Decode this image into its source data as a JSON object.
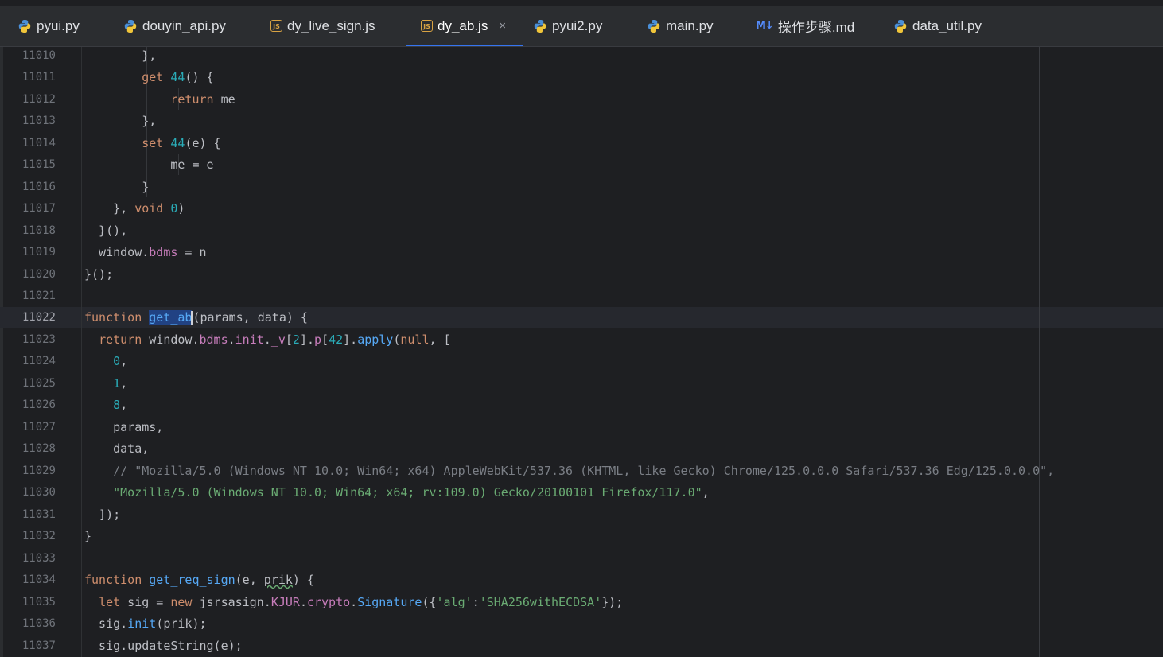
{
  "tabs": [
    {
      "label": "pyui.py",
      "icon": "python-icon"
    },
    {
      "label": "douyin_api.py",
      "icon": "python-icon"
    },
    {
      "label": "dy_live_sign.js",
      "icon": "js-icon"
    },
    {
      "label": "dy_ab.js",
      "icon": "js-icon",
      "active": true
    },
    {
      "label": "pyui2.py",
      "icon": "python-icon"
    },
    {
      "label": "main.py",
      "icon": "python-icon"
    },
    {
      "label": "操作步骤.md",
      "icon": "markdown-icon"
    },
    {
      "label": "data_util.py",
      "icon": "python-icon"
    }
  ],
  "tab_close_glyph": "×",
  "icon_glyphs": {
    "js": "JS",
    "md": "M↓"
  },
  "editor": {
    "current_line": "11022",
    "lines": [
      {
        "n": "11010",
        "t": [
          "        },"
        ]
      },
      {
        "n": "11011",
        "t": [
          "        ",
          "get",
          " ",
          "44",
          "() {"
        ]
      },
      {
        "n": "11012",
        "t": [
          "            ",
          "return",
          " me"
        ]
      },
      {
        "n": "11013",
        "t": [
          "        },"
        ]
      },
      {
        "n": "11014",
        "t": [
          "        ",
          "set",
          " ",
          "44",
          "(e) {"
        ]
      },
      {
        "n": "11015",
        "t": [
          "            me = e"
        ]
      },
      {
        "n": "11016",
        "t": [
          "        }"
        ]
      },
      {
        "n": "11017",
        "t": [
          "    }, ",
          "void",
          " ",
          "0",
          ")"
        ]
      },
      {
        "n": "11018",
        "t": [
          "  }(),"
        ]
      },
      {
        "n": "11019",
        "t": [
          "  window.",
          "bdms",
          " = n"
        ]
      },
      {
        "n": "11020",
        "t": [
          "}();"
        ]
      },
      {
        "n": "11021",
        "t": [
          ""
        ]
      },
      {
        "n": "11022",
        "t": [
          "function",
          " ",
          "get_ab",
          "(params, data) {"
        ]
      },
      {
        "n": "11023",
        "t": [
          "  ",
          "return",
          " window.",
          "bdms",
          ".",
          "init",
          ".",
          "_v",
          "[",
          "2",
          "].",
          "p",
          "[",
          "42",
          "].",
          "apply",
          "(",
          "null",
          ", ["
        ]
      },
      {
        "n": "11024",
        "t": [
          "    ",
          "0",
          ","
        ]
      },
      {
        "n": "11025",
        "t": [
          "    ",
          "1",
          ","
        ]
      },
      {
        "n": "11026",
        "t": [
          "    ",
          "8",
          ","
        ]
      },
      {
        "n": "11027",
        "t": [
          "    params,"
        ]
      },
      {
        "n": "11028",
        "t": [
          "    data,"
        ]
      },
      {
        "n": "11029",
        "t": [
          "    // \"Mozilla/5.0 (Windows NT 10.0; Win64; x64) AppleWebKit/537.36 (",
          "KHTML",
          ", like Gecko) Chrome/125.0.0.0 Safari/537.36 Edg/125.0.0.0\","
        ]
      },
      {
        "n": "11030",
        "t": [
          "    ",
          "\"Mozilla/5.0 (Windows NT 10.0; Win64; x64; rv:109.0) Gecko/20100101 Firefox/117.0\"",
          ","
        ]
      },
      {
        "n": "11031",
        "t": [
          "  ]);"
        ]
      },
      {
        "n": "11032",
        "t": [
          "}"
        ]
      },
      {
        "n": "11033",
        "t": [
          ""
        ]
      },
      {
        "n": "11034",
        "t": [
          "function",
          " ",
          "get_req_sign",
          "(e, ",
          "prik",
          ") {"
        ]
      },
      {
        "n": "11035",
        "t": [
          "  ",
          "let",
          " sig = ",
          "new",
          " jsrsasign.",
          "KJUR",
          ".",
          "crypto",
          ".",
          "Signature",
          "({",
          "'alg'",
          ":",
          "'SHA256withECDSA'",
          "});"
        ]
      },
      {
        "n": "11036",
        "t": [
          "  sig.",
          "init",
          "(prik);"
        ]
      },
      {
        "n": "11037",
        "t": [
          "  sig.updateString(e);"
        ]
      }
    ]
  },
  "colors": {
    "keyword": "#cf8e6d",
    "number": "#2aacb8",
    "function": "#56a8f5",
    "property": "#c77dbb",
    "string": "#6aab73",
    "comment": "#7a7e85",
    "accent": "#3574f0"
  }
}
